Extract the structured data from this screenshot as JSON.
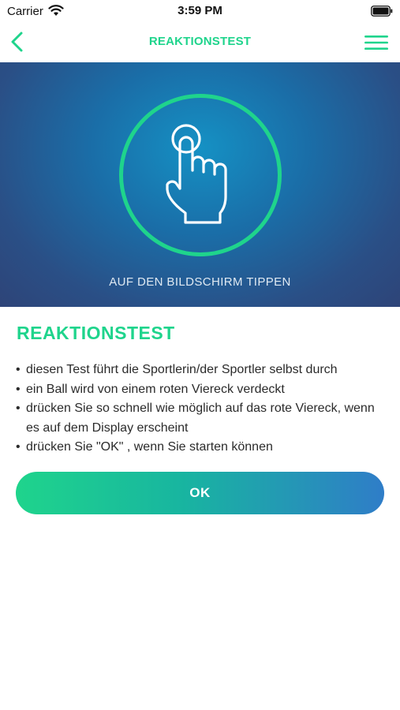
{
  "status_bar": {
    "carrier": "Carrier",
    "time": "3:59 PM"
  },
  "nav": {
    "title": "REAKTIONSTEST",
    "back_icon": "chevron-left-icon",
    "menu_icon": "hamburger-menu-icon"
  },
  "hero": {
    "caption": "AUF DEN BILDSCHIRM TIPPEN",
    "icon": "tap-hand-icon"
  },
  "content": {
    "title": "REAKTIONSTEST",
    "bullets": [
      "diesen Test führt die Sportlerin/der Sportler selbst durch",
      "ein Ball wird von einem roten Viereck verdeckt",
      "drücken Sie so schnell wie möglich auf das rote Viereck, wenn es auf dem Display erscheint",
      "drücken Sie \"OK\" , wenn Sie starten können"
    ]
  },
  "ok_button": {
    "label": "OK"
  },
  "colors": {
    "accent": "#1fd48c",
    "hero_blue": "#1a6ea8",
    "button_end": "#2f7dc8"
  }
}
